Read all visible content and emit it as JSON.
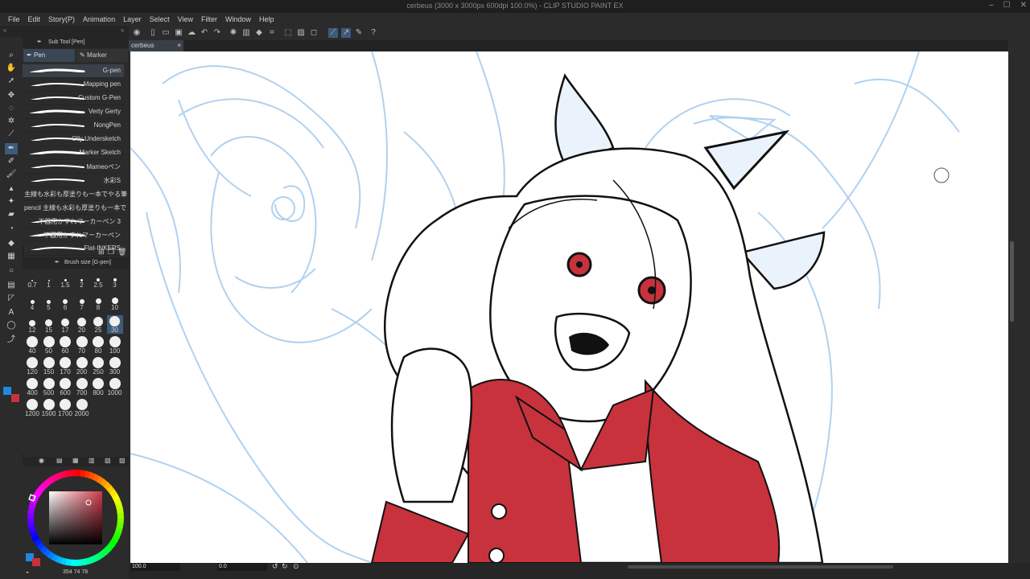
{
  "window": {
    "title": "cerbeus (3000 x 3000px 600dpi 100.0%) - CLIP STUDIO PAINT EX",
    "controls": [
      "–",
      "☐",
      "✕"
    ]
  },
  "menu": [
    "File",
    "Edit",
    "Story(P)",
    "Animation",
    "Layer",
    "Select",
    "View",
    "Filter",
    "Window",
    "Help"
  ],
  "document_tab": {
    "label": "cerbeus",
    "close": "×"
  },
  "subtool": {
    "header": "Sub Tool [Pen]",
    "tabs": [
      "Pen",
      "Marker"
    ],
    "brushes": [
      {
        "name": "G-pen",
        "active": true,
        "stroke": true
      },
      {
        "name": "Mapping pen",
        "stroke": true
      },
      {
        "name": "Custom G-Pen",
        "stroke": true
      },
      {
        "name": "Verty Gerty",
        "stroke": true
      },
      {
        "name": "NongPen",
        "stroke": true
      },
      {
        "name": "Olly Undersketch",
        "stroke": true
      },
      {
        "name": "Marker Sketch",
        "stroke": true
      },
      {
        "name": "Mameoペン",
        "stroke": true
      },
      {
        "name": "水彩S",
        "stroke": true
      },
      {
        "name": "主線も水彩も厚塗りも一本でやる筆",
        "stroke": false
      },
      {
        "name": "pencil 主線も水彩も厚塗りも一本で",
        "stroke": false
      },
      {
        "name": "不器用かすれマーカーペン 3",
        "stroke": true
      },
      {
        "name": "不器用かすれマーカーペン",
        "stroke": true
      },
      {
        "name": "Flat-INKERS",
        "stroke": true
      }
    ]
  },
  "brush_size": {
    "header": "Brush size [G-pen]",
    "sizes": [
      "0.7",
      "1",
      "1.5",
      "2",
      "2.5",
      "3",
      "4",
      "5",
      "6",
      "7",
      "8",
      "10",
      "12",
      "15",
      "17",
      "20",
      "25",
      "30",
      "40",
      "50",
      "60",
      "70",
      "80",
      "100",
      "120",
      "150",
      "170",
      "200",
      "250",
      "300",
      "400",
      "500",
      "600",
      "700",
      "800",
      "1000",
      "1200",
      "1500",
      "1700",
      "2000"
    ],
    "selected": "30"
  },
  "colors": {
    "main": "#1e88e5",
    "sub": "#c8323d",
    "accent": "#3d5a7a"
  },
  "color_values": {
    "h": "354",
    "s": "74",
    "v": "78"
  },
  "status": {
    "zoom": "100.0",
    "angle": "0.0"
  }
}
